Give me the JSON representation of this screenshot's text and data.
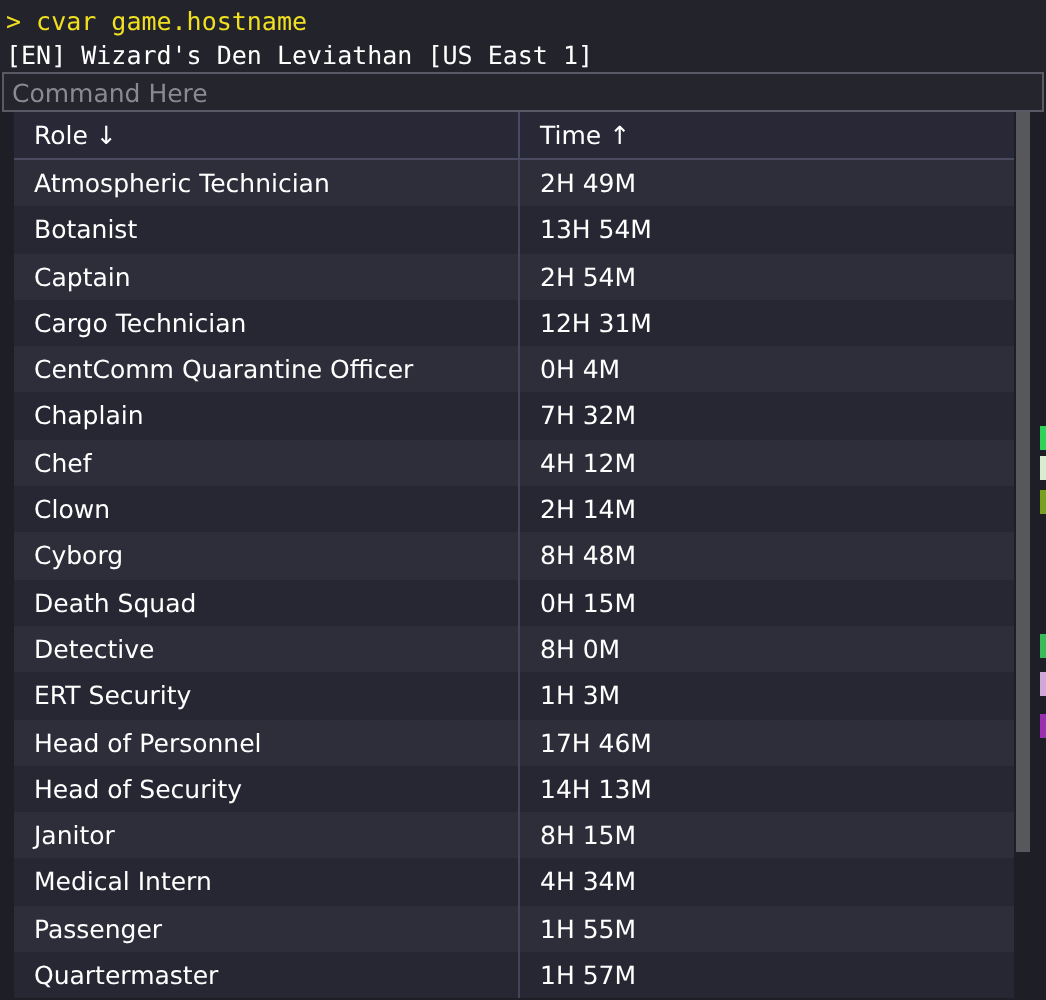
{
  "console": {
    "command": "> cvar game.hostname",
    "output": "[EN] Wizard's Den Leviathan [US East 1]",
    "input": {
      "placeholder": "Command Here"
    }
  },
  "table": {
    "columns": [
      {
        "label": "Role ↓"
      },
      {
        "label": "Time ↑"
      }
    ],
    "rows": [
      {
        "role": "Atmospheric Technician",
        "time": "2H 49M"
      },
      {
        "role": "Botanist",
        "time": "13H 54M"
      },
      {
        "role": "Captain",
        "time": "2H 54M"
      },
      {
        "role": "Cargo Technician",
        "time": "12H 31M"
      },
      {
        "role": "CentComm Quarantine Officer",
        "time": "0H 4M"
      },
      {
        "role": "Chaplain",
        "time": "7H 32M"
      },
      {
        "role": "Chef",
        "time": "4H 12M"
      },
      {
        "role": "Clown",
        "time": "2H 14M"
      },
      {
        "role": "Cyborg",
        "time": "8H 48M"
      },
      {
        "role": "Death Squad",
        "time": "0H 15M"
      },
      {
        "role": "Detective",
        "time": "8H 0M"
      },
      {
        "role": "ERT Security",
        "time": "1H 3M"
      },
      {
        "role": "Head of Personnel",
        "time": "17H 46M"
      },
      {
        "role": "Head of Security",
        "time": "14H 13M"
      },
      {
        "role": "Janitor",
        "time": "8H 15M"
      },
      {
        "role": "Medical Intern",
        "time": "4H 34M"
      },
      {
        "role": "Passenger",
        "time": "1H 55M"
      },
      {
        "role": "Quartermaster",
        "time": "1H 57M"
      }
    ]
  }
}
